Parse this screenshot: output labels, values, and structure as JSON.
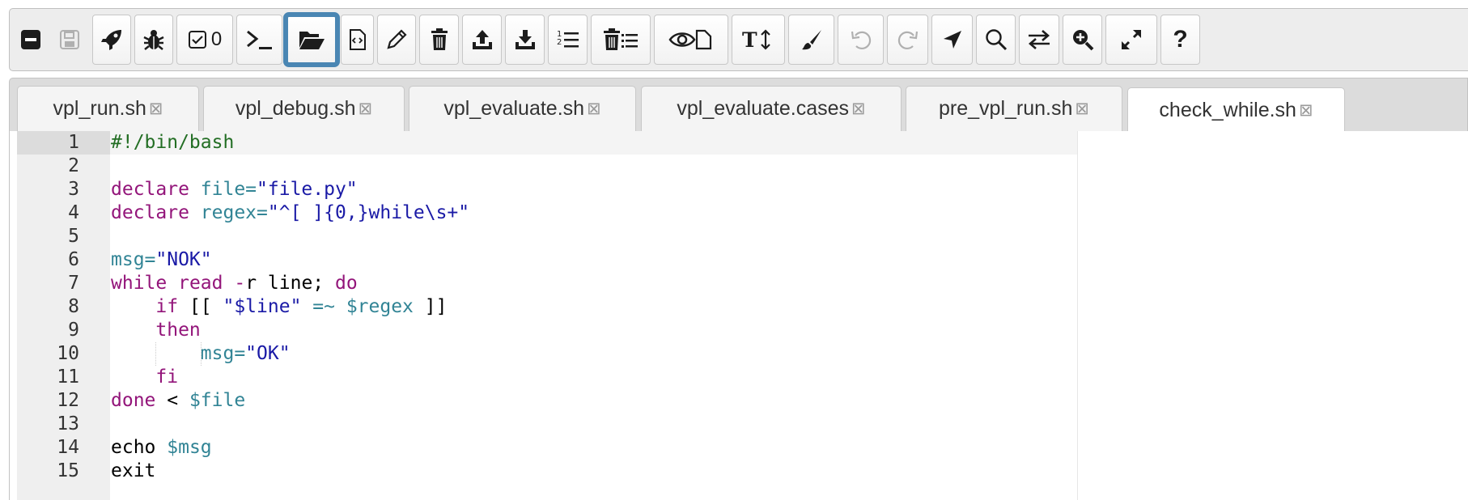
{
  "toolbar": {
    "count_label": "0",
    "icons": [
      "collapse-icon",
      "save-icon",
      "run-icon",
      "debug-icon",
      "evaluate-icon",
      "console-icon",
      "open-folder-icon",
      "new-file-icon",
      "rename-icon",
      "delete-icon",
      "upload-icon",
      "download-icon",
      "line-numbers-icon",
      "delete-all-icon",
      "view-files-icon",
      "font-size-icon",
      "theme-brush-icon",
      "undo-icon",
      "redo-icon",
      "go-to-line-icon",
      "search-icon",
      "replace-icon",
      "zoom-in-icon",
      "fullscreen-icon",
      "help-icon"
    ],
    "help_label": "?"
  },
  "tabs": [
    {
      "label": "vpl_run.sh",
      "close": "⊠"
    },
    {
      "label": "vpl_debug.sh",
      "close": "⊠"
    },
    {
      "label": "vpl_evaluate.sh",
      "close": "⊠"
    },
    {
      "label": "vpl_evaluate.cases",
      "close": "⊠"
    },
    {
      "label": "pre_vpl_run.sh",
      "close": "⊠"
    },
    {
      "label": "check_while.sh",
      "close": "⊠",
      "active": true
    }
  ],
  "editor": {
    "lines": [
      {
        "num": "1",
        "segments": [
          {
            "t": "#!/bin/bash",
            "c": "comment"
          }
        ]
      },
      {
        "num": "2",
        "segments": []
      },
      {
        "num": "3",
        "segments": [
          {
            "t": "declare",
            "c": "kw"
          },
          {
            "t": " file=",
            "c": "var"
          },
          {
            "t": "\"file.py\"",
            "c": "str"
          }
        ]
      },
      {
        "num": "4",
        "segments": [
          {
            "t": "declare",
            "c": "kw"
          },
          {
            "t": " regex=",
            "c": "var"
          },
          {
            "t": "\"^[ ]{0,}while\\s+\"",
            "c": "str"
          }
        ]
      },
      {
        "num": "5",
        "segments": []
      },
      {
        "num": "6",
        "segments": [
          {
            "t": "msg=",
            "c": "var"
          },
          {
            "t": "\"NOK\"",
            "c": "str"
          }
        ]
      },
      {
        "num": "7",
        "segments": [
          {
            "t": "while",
            "c": "kw"
          },
          {
            "t": " ",
            "c": "plain"
          },
          {
            "t": "read",
            "c": "kw"
          },
          {
            "t": " -",
            "c": "kw"
          },
          {
            "t": "r line; ",
            "c": "plain"
          },
          {
            "t": "do",
            "c": "kw"
          }
        ]
      },
      {
        "num": "8",
        "segments": [
          {
            "t": "    ",
            "c": "plain"
          },
          {
            "t": "if",
            "c": "kw"
          },
          {
            "t": " [[ ",
            "c": "plain"
          },
          {
            "t": "\"$line\"",
            "c": "str"
          },
          {
            "t": " =~ ",
            "c": "var"
          },
          {
            "t": "$regex",
            "c": "var"
          },
          {
            "t": " ]]",
            "c": "plain"
          }
        ]
      },
      {
        "num": "9",
        "segments": [
          {
            "t": "    ",
            "c": "plain"
          },
          {
            "t": "then",
            "c": "kw"
          }
        ]
      },
      {
        "num": "10",
        "segments": [
          {
            "t": "        ",
            "c": "plain"
          },
          {
            "t": "msg=",
            "c": "var"
          },
          {
            "t": "\"OK\"",
            "c": "str"
          }
        ],
        "guides": 2
      },
      {
        "num": "11",
        "segments": [
          {
            "t": "    ",
            "c": "plain"
          },
          {
            "t": "fi",
            "c": "kw"
          }
        ]
      },
      {
        "num": "12",
        "segments": [
          {
            "t": "done",
            "c": "kw"
          },
          {
            "t": " < ",
            "c": "plain"
          },
          {
            "t": "$file",
            "c": "var"
          }
        ]
      },
      {
        "num": "13",
        "segments": []
      },
      {
        "num": "14",
        "segments": [
          {
            "t": "echo",
            "c": "plain"
          },
          {
            "t": " ",
            "c": "plain"
          },
          {
            "t": "$msg",
            "c": "var"
          }
        ]
      },
      {
        "num": "15",
        "segments": [
          {
            "t": "exit",
            "c": "plain"
          }
        ]
      }
    ]
  }
}
